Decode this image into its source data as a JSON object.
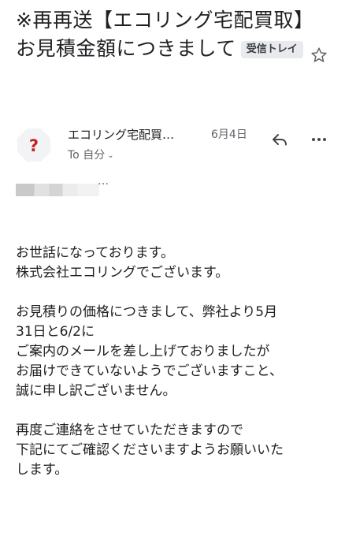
{
  "email": {
    "subject": "※再再送【エコリング宅配買取】お見積金額につきまして",
    "label": "受信トレイ",
    "sender": "エコリング宅配買…",
    "date": "6月4日",
    "recipient": "To 自分",
    "snippet_ellipsis": "…",
    "body_paragraphs": [
      "お世話になっております。\n株式会社エコリングでございます。",
      "お見積りの価格につきまして、弊社より5月\n31日と6/2に\nご案内のメールを差し上げておりましたが\nお届けできていないようでございますこと、\n誠に申し訳ございません。",
      "再度ご連絡をさせていただきますので\n下記にてご確認くださいますようお願いいた\nします。"
    ]
  },
  "icons": {
    "star": "star-outline-icon",
    "avatar": "unknown-sender-question-icon",
    "reply": "reply-arrow-icon",
    "more": "more-horizontal-icon",
    "recipient_expand": "chevron-down-icon"
  },
  "colors": {
    "avatar_symbol": "#c5221f",
    "avatar_background": "#f1f3f4",
    "label_chip_background": "#e8eaed"
  }
}
